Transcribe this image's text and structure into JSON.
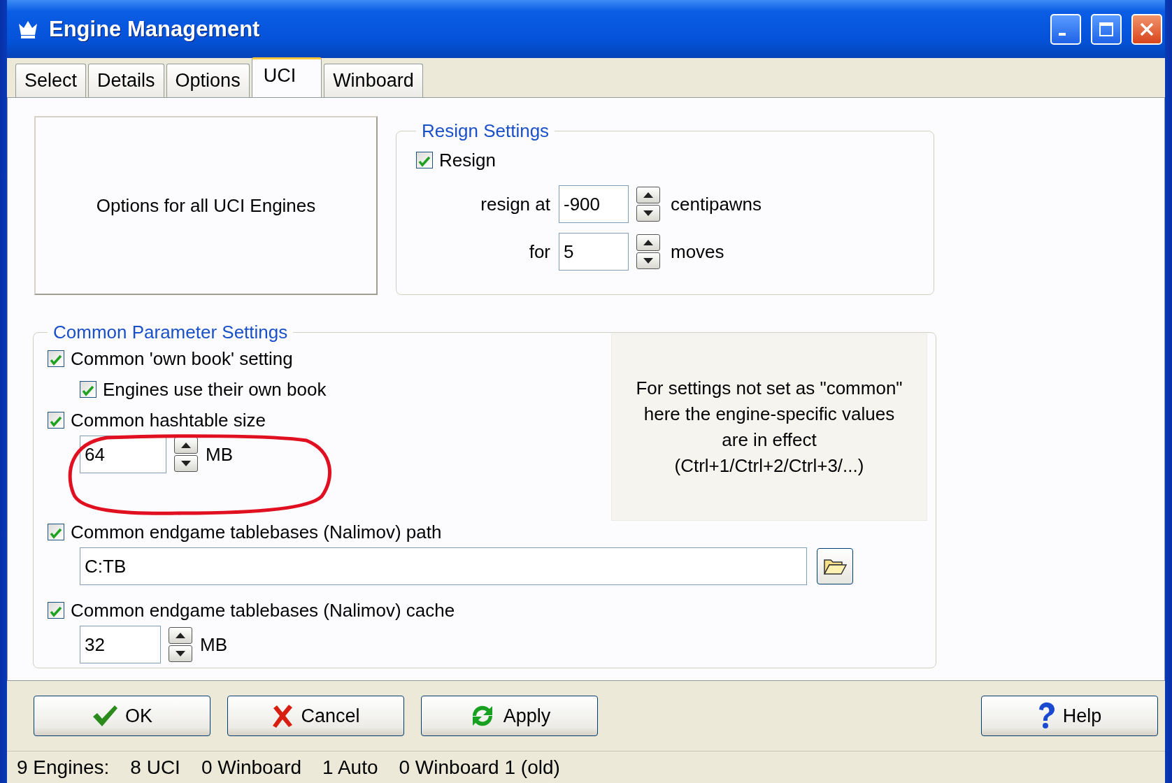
{
  "window": {
    "title": "Engine Management"
  },
  "tabs": [
    {
      "label": "Select",
      "selected": false
    },
    {
      "label": "Details",
      "selected": false
    },
    {
      "label": "Options",
      "selected": false
    },
    {
      "label": "UCI",
      "selected": true
    },
    {
      "label": "Winboard",
      "selected": false
    }
  ],
  "uci_box": {
    "label": "Options for all UCI Engines"
  },
  "resign_settings": {
    "title": "Resign Settings",
    "resign": {
      "label": "Resign",
      "checked": true
    },
    "rows": [
      {
        "label": "resign at",
        "value": "-900",
        "unit": "centipawns"
      },
      {
        "label": "for",
        "value": "5",
        "unit": "moves"
      }
    ]
  },
  "common_parameter_settings": {
    "title": "Common Parameter Settings",
    "own_book": {
      "label": "Common 'own book' setting",
      "checked": true
    },
    "engines_own_book": {
      "label": "Engines use their own book",
      "checked": true
    },
    "hashtable": {
      "label": "Common hashtable size",
      "checked": true,
      "value": "64",
      "unit": "MB"
    },
    "tablebases_path": {
      "label": "Common endgame tablebases (Nalimov) path",
      "checked": true,
      "value": "C:TB"
    },
    "tablebases_cache": {
      "label": "Common endgame tablebases (Nalimov) cache",
      "checked": true,
      "value": "32",
      "unit": "MB"
    },
    "note": "For settings not set as \"common\"\nhere the engine-specific values\nare in effect\n(Ctrl+1/Ctrl+2/Ctrl+3/...)"
  },
  "buttons": [
    {
      "label": "OK",
      "kind": "ok"
    },
    {
      "label": "Cancel",
      "kind": "cancel"
    },
    {
      "label": "Apply",
      "kind": "apply"
    },
    {
      "label": "Help",
      "kind": "help"
    }
  ],
  "status_bar": [
    "9 Engines:",
    "8 UCI",
    "0 Winboard",
    "1 Auto",
    "0 Winboard 1 (old)"
  ]
}
